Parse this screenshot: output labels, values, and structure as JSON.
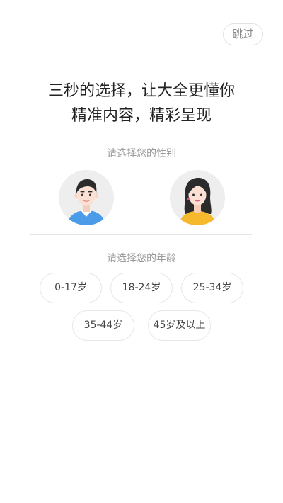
{
  "header": {
    "skip_label": "跳过"
  },
  "headline": {
    "line1": "三秒的选择，让大全更懂你",
    "line2": "精准内容，精彩呈现"
  },
  "gender": {
    "label": "请选择您的性别",
    "options": [
      {
        "icon": "male-avatar-icon"
      },
      {
        "icon": "female-avatar-icon"
      }
    ]
  },
  "age": {
    "label": "请选择您的年龄",
    "options": [
      "0-17岁",
      "18-24岁",
      "25-34岁",
      "35-44岁",
      "45岁及以上"
    ]
  },
  "colors": {
    "male_shirt": "#4a9be8",
    "female_shirt": "#f6b82c",
    "hair": "#2b2b2b",
    "skin": "#fbe0d3",
    "avatar_bg": "#eeeeee"
  }
}
